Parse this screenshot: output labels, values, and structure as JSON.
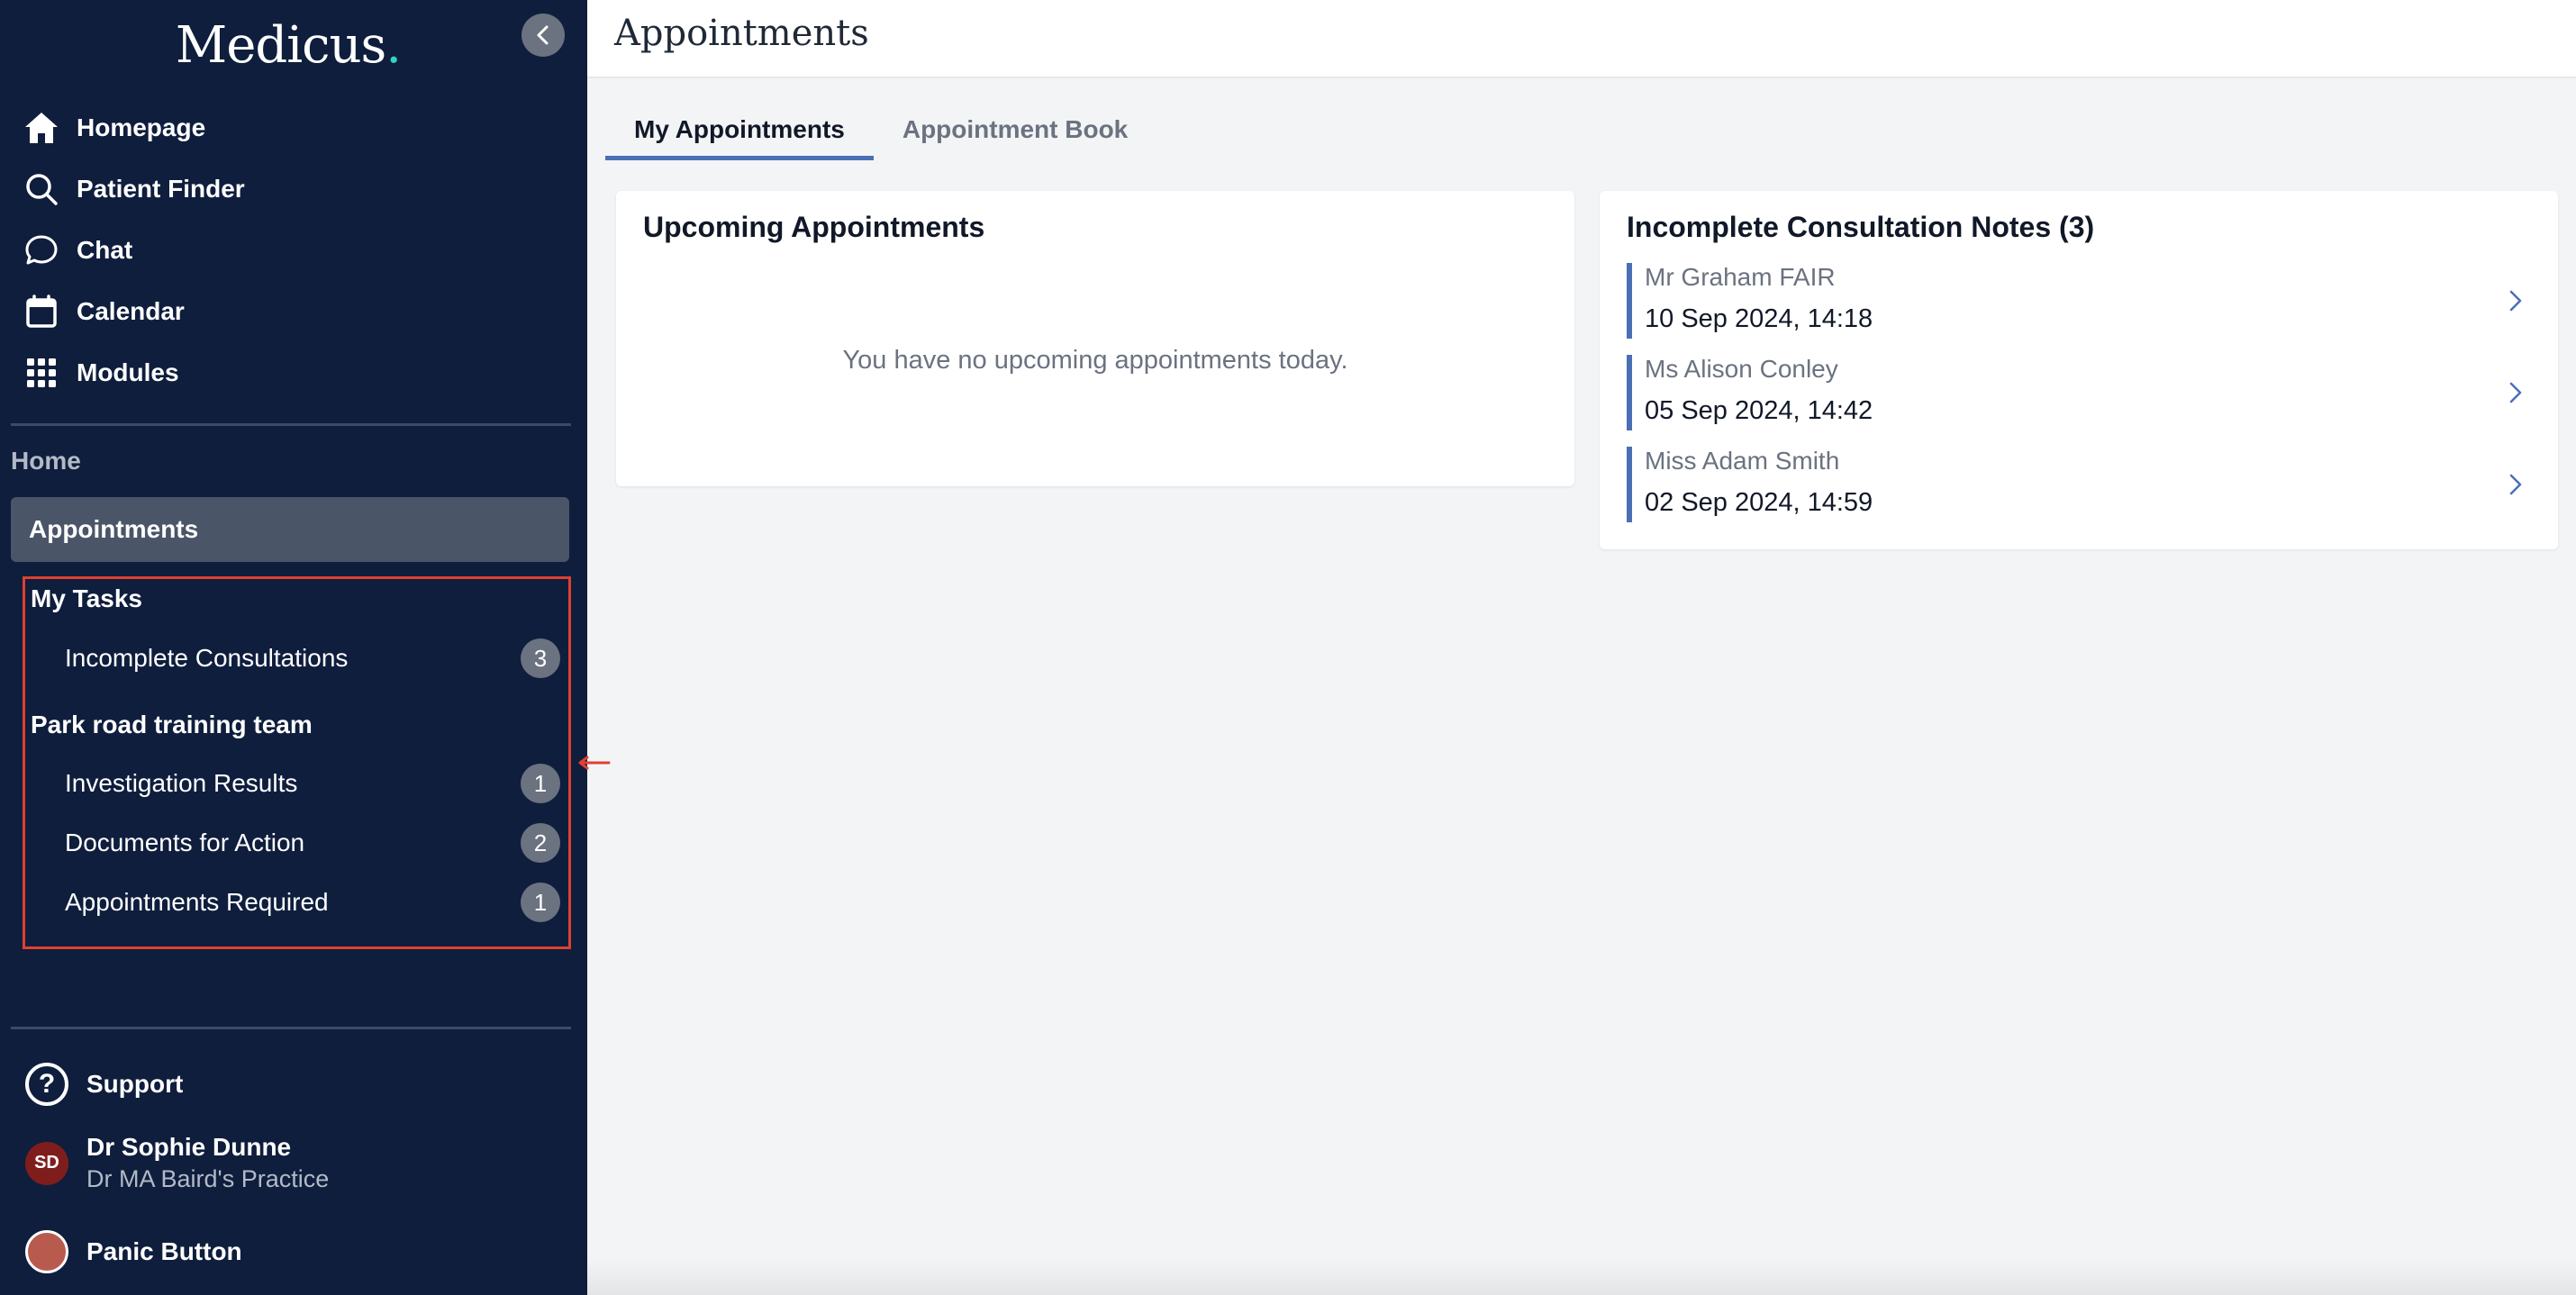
{
  "app": {
    "logo": "Medicus",
    "logo_dot": "."
  },
  "sidebar": {
    "nav": [
      {
        "label": "Homepage",
        "icon": "home-icon"
      },
      {
        "label": "Patient Finder",
        "icon": "search-icon"
      },
      {
        "label": "Chat",
        "icon": "chat-icon"
      },
      {
        "label": "Calendar",
        "icon": "calendar-icon"
      },
      {
        "label": "Modules",
        "icon": "grid-icon"
      }
    ],
    "section_label": "Home",
    "active_item": "Appointments",
    "tasks": {
      "group1": "My Tasks",
      "group1_items": [
        {
          "label": "Incomplete Consultations",
          "count": "3"
        }
      ],
      "group2": "Park road training team",
      "group2_items": [
        {
          "label": "Investigation Results",
          "count": "1"
        },
        {
          "label": "Documents for Action",
          "count": "2"
        },
        {
          "label": "Appointments Required",
          "count": "1"
        }
      ]
    },
    "support": "Support",
    "user": {
      "initials": "SD",
      "name": "Dr Sophie Dunne",
      "practice": "Dr MA Baird's Practice"
    },
    "panic": "Panic Button"
  },
  "header": {
    "title": "Appointments"
  },
  "tabs": [
    {
      "label": "My Appointments",
      "active": true
    },
    {
      "label": "Appointment Book",
      "active": false
    }
  ],
  "upcoming": {
    "title": "Upcoming Appointments",
    "empty": "You have no upcoming appointments today."
  },
  "notes": {
    "title": "Incomplete Consultation Notes (3)",
    "items": [
      {
        "name": "Mr Graham FAIR",
        "date": "10 Sep 2024, 14:18"
      },
      {
        "name": "Ms Alison Conley",
        "date": "05 Sep 2024, 14:42"
      },
      {
        "name": "Miss Adam Smith",
        "date": "02 Sep 2024, 14:59"
      }
    ]
  },
  "colors": {
    "sidebar": "#0f1e3d",
    "accent": "#4a6fb5",
    "highlight_box": "#e0402f"
  }
}
